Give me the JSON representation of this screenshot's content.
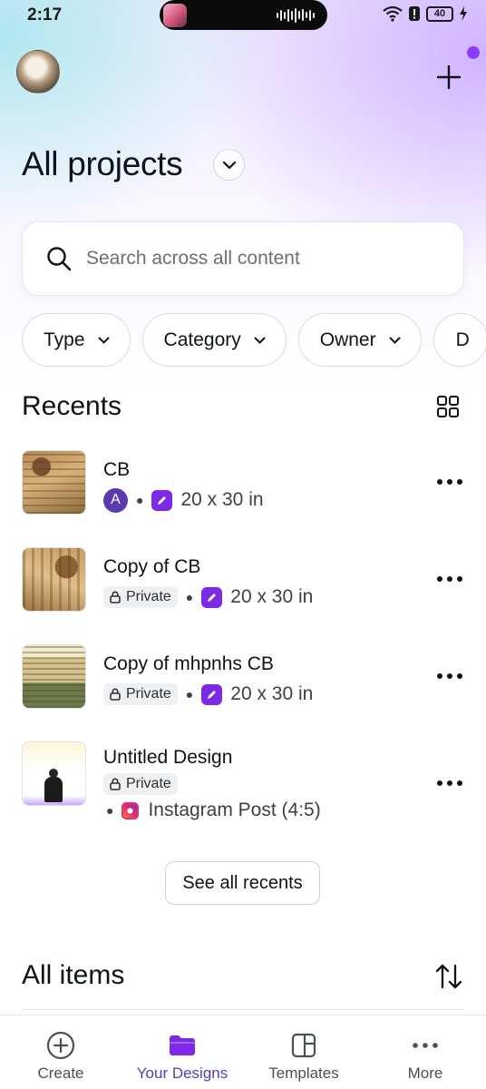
{
  "status_bar": {
    "time": "2:17",
    "battery": "40"
  },
  "header": {
    "title": "All projects"
  },
  "search": {
    "placeholder": "Search across all content",
    "value": ""
  },
  "filters": [
    {
      "label": "Type"
    },
    {
      "label": "Category"
    },
    {
      "label": "Owner"
    },
    {
      "label": "D"
    }
  ],
  "recents": {
    "title": "Recents",
    "items": [
      {
        "name": "CB",
        "owner_initial": "A",
        "size": "20 x 30 in"
      },
      {
        "name": "Copy of CB",
        "visibility": "Private",
        "size": "20 x 30 in"
      },
      {
        "name": "Copy of mhpnhs CB",
        "visibility": "Private",
        "size": "20 x 30 in"
      },
      {
        "name": "Untitled Design",
        "visibility": "Private",
        "size": "Instagram Post (4:5)"
      }
    ],
    "see_all_label": "See all recents"
  },
  "all_items": {
    "title": "All items"
  },
  "bottom_nav": [
    {
      "label": "Create",
      "icon": "plus-circle-icon"
    },
    {
      "label": "Your Designs",
      "icon": "folder-icon"
    },
    {
      "label": "Templates",
      "icon": "templates-icon"
    },
    {
      "label": "More",
      "icon": "more-dots-icon"
    }
  ],
  "colors": {
    "brand_purple": "#8b3dff",
    "owner_badge": "#5b3ab0",
    "active_nav": "#5b3ab0",
    "text": "#0e1318"
  }
}
